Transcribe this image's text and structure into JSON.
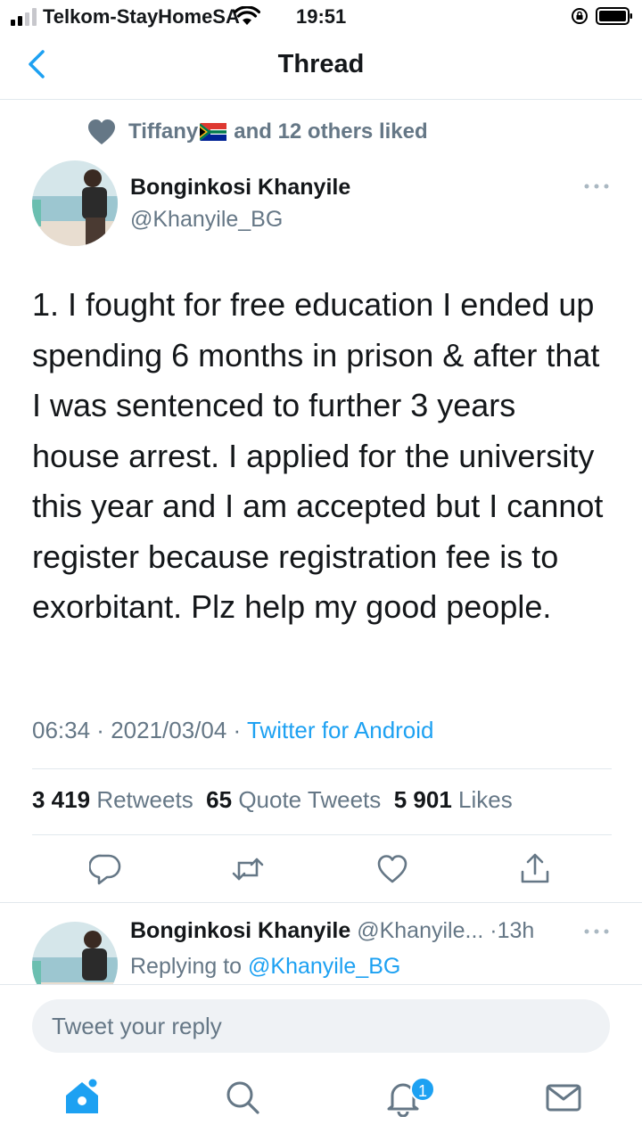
{
  "status_bar": {
    "carrier": "Telkom-StayHomeSA",
    "time": "19:51"
  },
  "nav": {
    "title": "Thread"
  },
  "liked": {
    "user": "Tiffany",
    "rest": "and 12 others liked"
  },
  "tweet": {
    "author_name": "Bonginkosi Khanyile",
    "author_handle": "@Khanyile_BG",
    "text": "1. I fought for free education I ended up spending 6 months in prison & after that I was sentenced to further  3 years house arrest. I  applied for the university this year and I am accepted but I cannot register because registration fee is to exorbitant. Plz help my good people.",
    "time": "06:34",
    "date": "2021/03/04",
    "app": "Twitter for Android",
    "retweets_count": "3 419",
    "retweets_label": "Retweets",
    "quotes_count": "65",
    "quotes_label": "Quote Tweets",
    "likes_count": "5 901",
    "likes_label": "Likes"
  },
  "reply": {
    "author_name": "Bonginkosi Khanyile",
    "author_handle": "@Khanyile...",
    "age": "13h",
    "replying_prefix": "Replying to",
    "replying_handle": "@Khanyile_BG"
  },
  "composer": {
    "placeholder": "Tweet your reply"
  },
  "tabbar": {
    "notification_badge": "1"
  },
  "colors": {
    "accent": "#1da1f2",
    "secondary_text": "#657786",
    "divider": "#e1e8ed"
  },
  "icons": [
    "signal-icon",
    "wifi-icon",
    "rotation-lock-icon",
    "battery-icon",
    "back-chevron-icon",
    "heart-icon",
    "south-africa-flag-icon",
    "more-icon",
    "reply-icon",
    "retweet-icon",
    "like-icon",
    "share-icon",
    "home-icon",
    "search-icon",
    "bell-icon",
    "mail-icon"
  ]
}
